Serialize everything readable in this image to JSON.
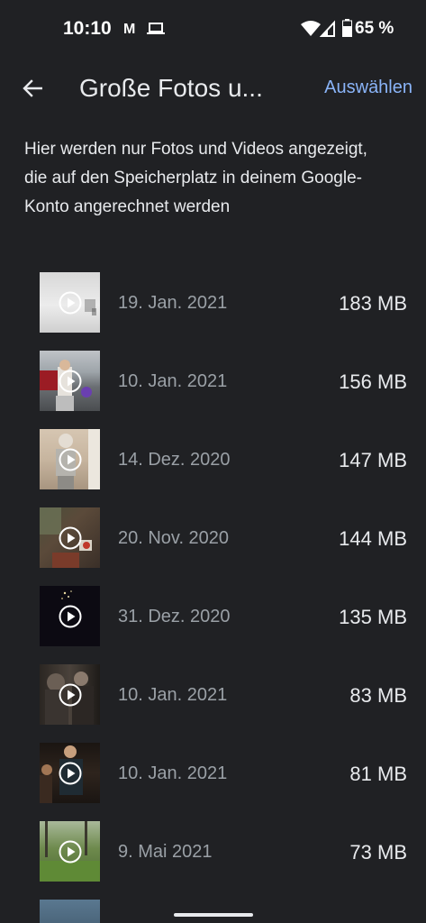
{
  "status_bar": {
    "time": "10:10",
    "notification_icons": [
      "gmail-icon",
      "laptop-icon"
    ],
    "system_icons": [
      "wifi-icon",
      "signal-icon",
      "battery-icon"
    ],
    "battery": "65 %"
  },
  "app_bar": {
    "back_icon": "arrow-back-icon",
    "title": "Große Fotos u...",
    "action_label": "Auswählen"
  },
  "description": "Hier werden nur Fotos und Videos angezeigt, die auf den Speicherplatz in deinem Google-Konto angerechnet werden",
  "items": [
    {
      "date": "19. Jan. 2021",
      "size": "183 MB",
      "type": "video"
    },
    {
      "date": "10. Jan. 2021",
      "size": "156 MB",
      "type": "video"
    },
    {
      "date": "14. Dez. 2020",
      "size": "147 MB",
      "type": "video"
    },
    {
      "date": "20. Nov. 2020",
      "size": "144 MB",
      "type": "video"
    },
    {
      "date": "31. Dez. 2020",
      "size": "135 MB",
      "type": "video"
    },
    {
      "date": "10. Jan. 2021",
      "size": "83 MB",
      "type": "video"
    },
    {
      "date": "10. Jan. 2021",
      "size": "81 MB",
      "type": "video"
    },
    {
      "date": "9. Mai 2021",
      "size": "73 MB",
      "type": "video"
    }
  ],
  "colors": {
    "background": "#202124",
    "accent": "#8ab4f8",
    "secondary_text": "#9aa0a6",
    "primary_text": "#e8eaed"
  }
}
